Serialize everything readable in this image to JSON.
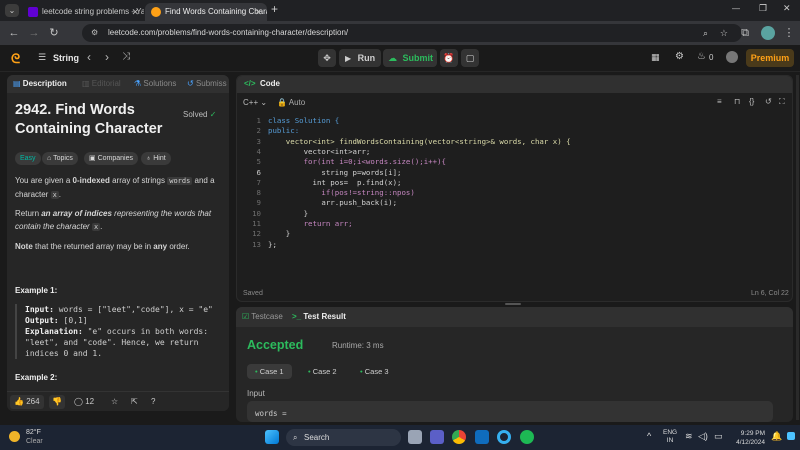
{
  "browser": {
    "tabs": [
      {
        "title": "leetcode string problems - Yah",
        "close": "✕"
      },
      {
        "title": "Find Words Containing Charact",
        "close": "✕"
      }
    ],
    "new_tab": "+",
    "url": "leetcode.com/problems/find-words-containing-character/description/",
    "window_controls": [
      "—",
      "❐",
      "✕"
    ]
  },
  "topbar": {
    "section": "String",
    "run_label": "Run",
    "submit_label": "Submit",
    "streak_count": "0",
    "premium_label": "Premium"
  },
  "left_tabs": [
    "Description",
    "Editorial",
    "Solutions",
    "Submiss"
  ],
  "problem": {
    "title": "2942. Find Words Containing Character",
    "status": "Solved",
    "tags": [
      "Easy",
      "Topics",
      "Companies",
      "Hint"
    ],
    "p1_a": "You are given a ",
    "p1_b": "0-indexed",
    "p1_c": " array of strings ",
    "p1_d": "words",
    "p1_e": " and a character ",
    "p1_f": "x",
    "p1_g": ".",
    "p2_a": "Return ",
    "p2_b": "an array of indices",
    "p2_c": " representing the words that contain the character ",
    "p2_d": "x",
    "p2_e": ".",
    "p3_a": "Note",
    "p3_b": " that the returned array may be in ",
    "p3_c": "any",
    "p3_d": " order.",
    "example1_heading": "Example 1:",
    "input_label": "Input:",
    "input_value": " words = [\"leet\",\"code\"], x = \"e\"",
    "output_label": "Output:",
    "output_value": " [0,1]",
    "explanation_label": "Explanation:",
    "explanation_l1": " \"e\" occurs in both words:",
    "explanation_l2": "\"leet\", and \"code\". Hence, we return",
    "explanation_l3": "indices 0 and 1.",
    "example2_heading": "Example 2:"
  },
  "footer": {
    "likes": "264",
    "comments": "12"
  },
  "code_panel": {
    "title": "Code",
    "language": "C++",
    "mode": "Auto",
    "lines": [
      "class Solution {",
      "public:",
      "    vector<int> findWordsContaining(vector<string>& words, char x) {",
      "        vector<int>arr;",
      "        for(int i=0;i<words.size();i++){",
      "            string p=words[i];",
      "          int pos=  p.find(x);",
      "            if(pos!=string::npos)",
      "            arr.push_back(i);",
      "        }",
      "        return arr;",
      "    }",
      "};"
    ],
    "saved_label": "Saved",
    "cursor_pos": "Ln 6, Col 22"
  },
  "result_panel": {
    "testcase_tab": "Testcase",
    "result_tab": "Test Result",
    "status": "Accepted",
    "runtime": "Runtime: 3 ms",
    "cases": [
      "Case 1",
      "Case 2",
      "Case 3"
    ],
    "input_label": "Input",
    "input_value": "words ="
  },
  "taskbar": {
    "temperature": "82°F",
    "weather": "Clear",
    "search_label": "Search",
    "lang_top": "ENG",
    "lang_bottom": "IN",
    "time": "9:29 PM",
    "date": "4/12/2024"
  },
  "colors": {
    "accent_green": "#2cbb5d",
    "leetcode_orange": "#ffa116",
    "premium": "#ffa116"
  }
}
